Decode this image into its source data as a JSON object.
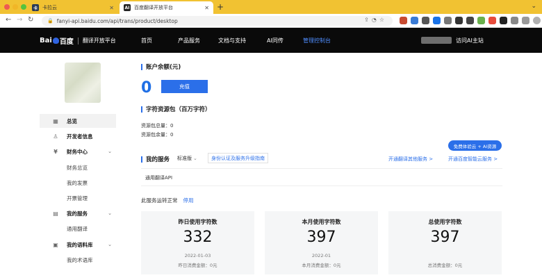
{
  "browser": {
    "tabs": [
      {
        "title": "卡拉云",
        "icon": "karayun-favicon"
      },
      {
        "title": "百度翻译开放平台",
        "icon": "ai-favicon"
      }
    ],
    "url": "fanyi-api.baidu.com/api/trans/product/desktop"
  },
  "header": {
    "logo_text": "Bai",
    "logo_text2": "百度",
    "platform": "翻译开放平台",
    "nav": [
      "首页",
      "产品服务",
      "文档与支持",
      "AI同传",
      "管理控制台"
    ],
    "active_nav": "管理控制台",
    "right_link": "访问AI主站"
  },
  "sidebar": {
    "items": [
      {
        "label": "总览",
        "icon": "grid-icon",
        "group": true
      },
      {
        "label": "开发者信息",
        "icon": "user-icon",
        "group": true
      },
      {
        "label": "财务中心",
        "icon": "finance-icon",
        "group": true
      },
      {
        "label": "财务总览",
        "sub": true
      },
      {
        "label": "我的发票",
        "sub": true
      },
      {
        "label": "开票管理",
        "sub": true
      },
      {
        "label": "我的服务",
        "icon": "document-icon",
        "group": true
      },
      {
        "label": "通用翻译",
        "sub": true
      },
      {
        "label": "我的语料库",
        "icon": "library-icon",
        "group": true
      },
      {
        "label": "我的术语库",
        "sub": true
      }
    ]
  },
  "main": {
    "balance_title": "账户余额(元)",
    "balance_value": "0",
    "recharge_label": "充值",
    "resource_title": "字符资源包（百万字符）",
    "resource_total": "资源包总量：0",
    "resource_left": "资源包余量：0",
    "services_title": "我的服务",
    "edition": "标准版",
    "upgrade_link": "身份认证及服务升级指南",
    "free_pill": "免费体验云 + AI资源",
    "link_other": "开通翻译其他服务 >",
    "link_cloud": "开通百度智能云服务 >",
    "api_tab": "通用翻译API",
    "status_text": "此服务运转正常",
    "stop_label": "停用",
    "cards": [
      {
        "title": "昨日使用字符数",
        "value": "332",
        "date": "2022-01-03",
        "fee": "昨日消费金额：0元"
      },
      {
        "title": "本月使用字符数",
        "value": "397",
        "date": "2022-01",
        "fee": "本月消费金额：0元"
      },
      {
        "title": "总使用字符数",
        "value": "397",
        "date": "",
        "fee": "总消费金额：0元"
      }
    ]
  },
  "colors": {
    "accent": "#2b6fe9",
    "header_bg": "#0a0a0a",
    "tabbar": "#f1c232"
  }
}
